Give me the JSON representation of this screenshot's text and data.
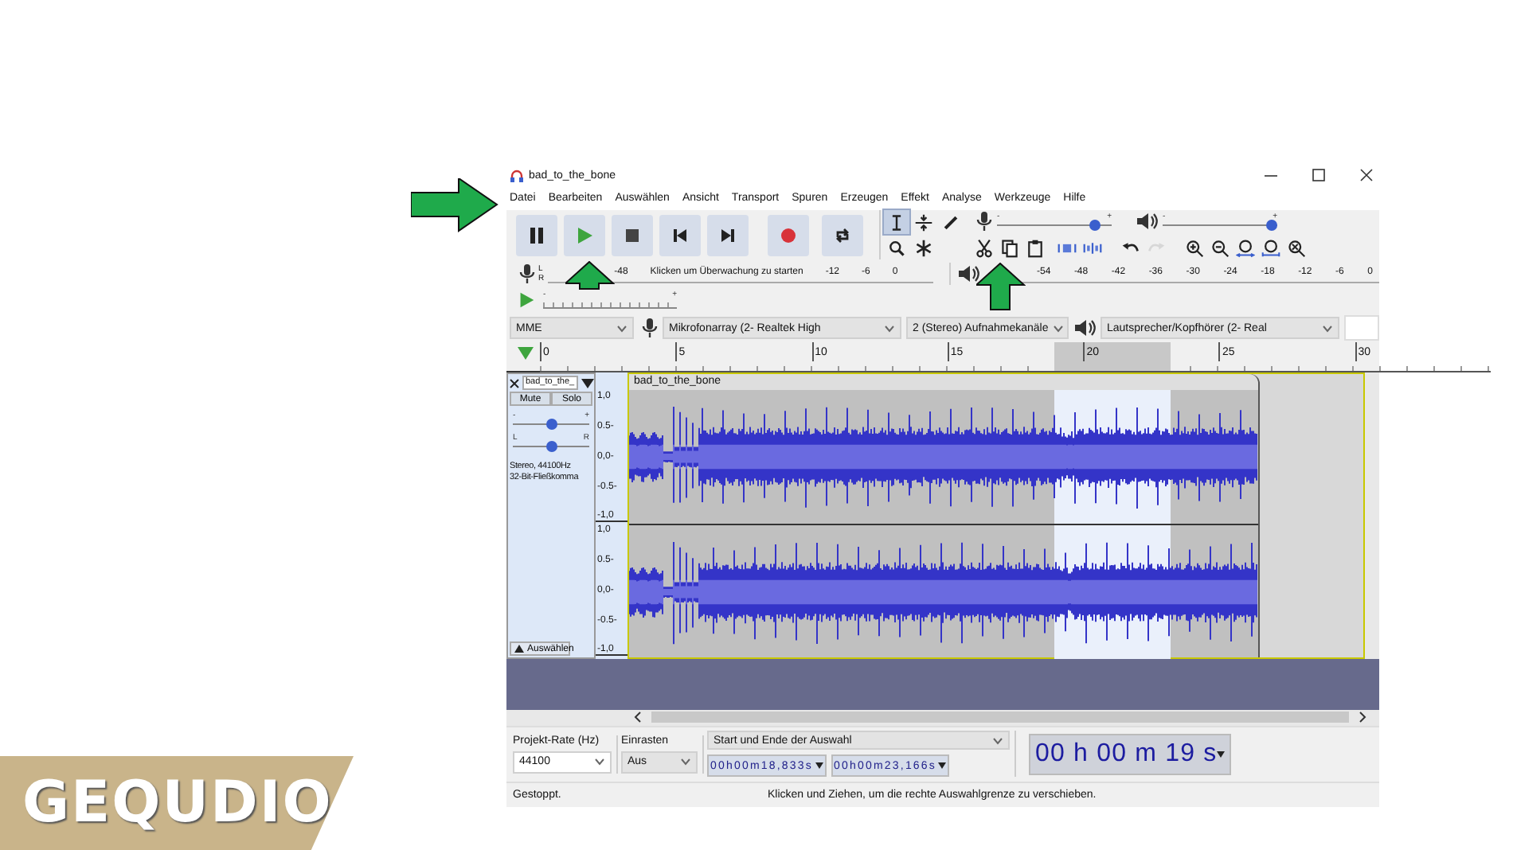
{
  "window": {
    "title": "bad_to_the_bone"
  },
  "menu": [
    "Datei",
    "Bearbeiten",
    "Auswählen",
    "Ansicht",
    "Transport",
    "Spuren",
    "Erzeugen",
    "Effekt",
    "Analyse",
    "Werkzeuge",
    "Hilfe"
  ],
  "transport_buttons": [
    {
      "kind": "pause"
    },
    {
      "kind": "play"
    },
    {
      "kind": "stop"
    },
    {
      "kind": "skip_start"
    },
    {
      "kind": "skip_end"
    },
    {
      "kind": "record"
    },
    {
      "kind": "loop"
    }
  ],
  "tools": [
    {
      "kind": "select",
      "selected": true
    },
    {
      "kind": "envelope",
      "selected": false
    },
    {
      "kind": "draw",
      "selected": false
    },
    {
      "kind": "zoom",
      "selected": false
    },
    {
      "kind": "multi",
      "selected": false
    }
  ],
  "mixer": {
    "record_volume": {
      "min_label": "-",
      "max_label": "+",
      "level": 0.85
    },
    "playback_volume": {
      "min_label": "-",
      "max_label": "+",
      "level": 0.95
    }
  },
  "edit_buttons": [
    {
      "kind": "cut",
      "disabled": false
    },
    {
      "kind": "copy",
      "disabled": false
    },
    {
      "kind": "paste",
      "disabled": false
    },
    {
      "kind": "trim",
      "disabled": false
    },
    {
      "kind": "silence",
      "disabled": false
    },
    {
      "kind": "undo",
      "disabled": false
    },
    {
      "kind": "redo",
      "disabled": true
    },
    {
      "kind": "zoom_in",
      "disabled": false
    },
    {
      "kind": "zoom_out",
      "disabled": false
    },
    {
      "kind": "fit_selection",
      "disabled": false
    },
    {
      "kind": "fit_project",
      "disabled": false
    },
    {
      "kind": "zoom_toggle",
      "disabled": false
    }
  ],
  "record_meter": {
    "channels": [
      "L",
      "R"
    ],
    "labels": [
      "-48",
      "Klicken um Überwachung zu starten",
      "-12",
      "-6",
      "0"
    ]
  },
  "playback_meter": {
    "labels": [
      "-54",
      "-48",
      "-42",
      "-36",
      "-30",
      "-24",
      "-18",
      "-12",
      "-6",
      "0"
    ]
  },
  "play_at_speed": {
    "min_label": "-",
    "max_label": "+"
  },
  "devices": {
    "host": "MME",
    "input": "Mikrofonarray (2- Realtek High",
    "channels": "2 (Stereo) Aufnahmekanäle",
    "output": "Lautsprecher/Kopfhörer (2- Real"
  },
  "ruler": {
    "ticks": [
      "0",
      "5",
      "10",
      "15",
      "20",
      "25",
      "30"
    ]
  },
  "track": {
    "name": "bad_to_the_",
    "mute": "Mute",
    "solo": "Solo",
    "gain": {
      "min_label": "-",
      "max_label": "+",
      "level": 0.5
    },
    "pan": {
      "min_label": "L",
      "max_label": "R",
      "level": 0.5
    },
    "format": [
      "Stereo, 44100Hz",
      "32-Bit-Fließkomma"
    ],
    "select_button": "Auswählen",
    "clip_name": "bad_to_the_bone",
    "channel_scales": [
      [
        "1,0",
        "0.5-",
        "0,0-",
        "-0.5-",
        "-1,0"
      ],
      [
        "1,0",
        "0.5-",
        "0,0-",
        "-0.5-",
        "-1,0"
      ]
    ]
  },
  "selection_toolbar": {
    "rate_label": "Projekt-Rate (Hz)",
    "rate": "44100",
    "snap_label": "Einrasten",
    "snap": "Aus",
    "mode": "Start und Ende der Auswahl",
    "start": "00h00m18,833s",
    "end": "00h00m23,166s"
  },
  "time_display": "00 h 00 m 19 s",
  "status_bar": [
    "Gestoppt.",
    "Klicken und Ziehen, um die rechte Auswahlgrenze zu verschieben."
  ],
  "callout_arrows": [
    {
      "kind": "right"
    },
    {
      "kind": "up"
    },
    {
      "kind": "up"
    }
  ],
  "logo": "GEQUDIO"
}
